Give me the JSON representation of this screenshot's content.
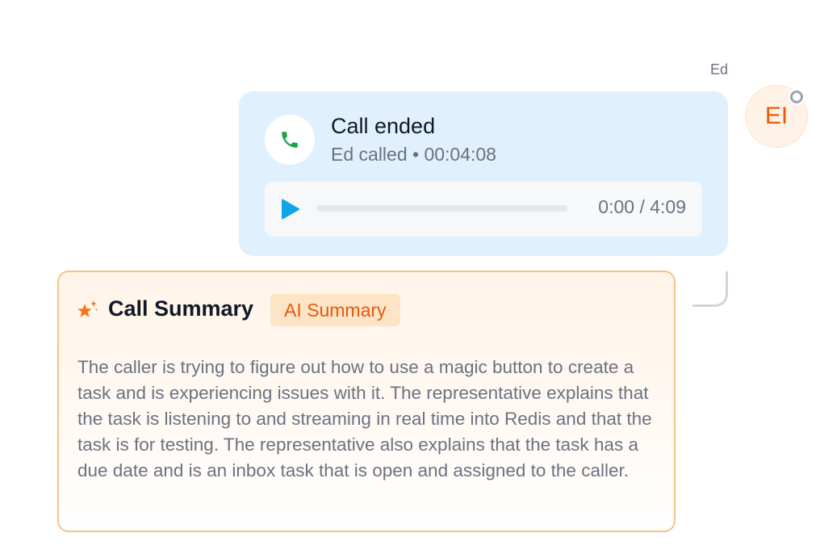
{
  "message": {
    "sender_name": "Ed",
    "avatar_initials": "EI"
  },
  "call": {
    "title": "Call ended",
    "subtitle": "Ed called • 00:04:08",
    "player": {
      "time_display": "0:00 / 4:09",
      "progress": 0
    }
  },
  "summary": {
    "title": "Call Summary",
    "badge": "AI Summary",
    "text": "The caller is trying to figure out how to use a magic button to create a task and is experiencing issues with it. The representative explains that the task is listening to and streaming in real time into Redis and that the task is for testing. The representative also explains that the task has a due date and is an inbox task that is open and assigned to the caller."
  },
  "icons": {
    "phone": "phone-icon",
    "play": "play-icon",
    "sparkle": "sparkle-icon",
    "presence": "presence-status-icon"
  },
  "colors": {
    "call_card_bg": "#e0f0fd",
    "phone_green": "#16a34a",
    "play_blue": "#0ea5e9",
    "accent_orange": "#ea580c",
    "summary_border": "#f6c28a"
  }
}
